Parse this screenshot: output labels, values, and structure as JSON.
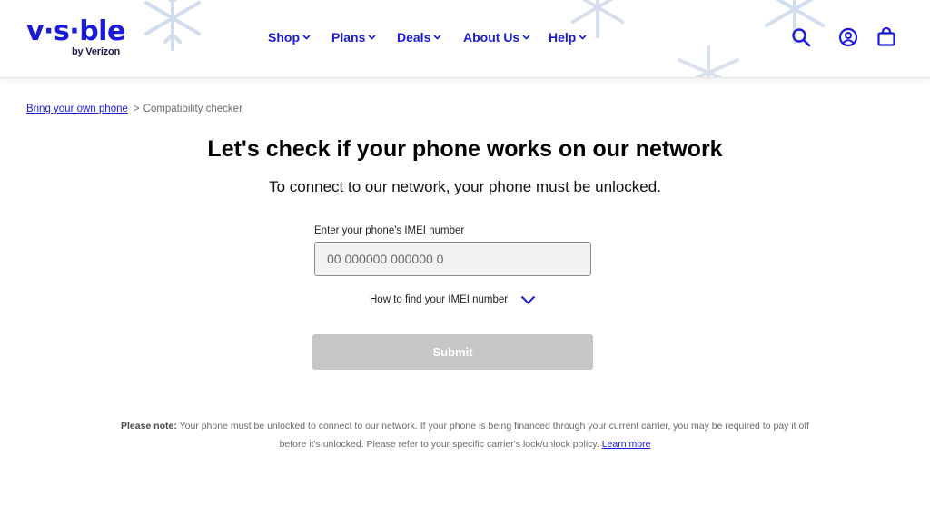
{
  "brand": {
    "logo_text": "v·s·ble",
    "logo_sub": "by Verizon",
    "accent_color": "#1a1adb"
  },
  "nav": {
    "items": [
      {
        "label": "Shop"
      },
      {
        "label": "Plans"
      },
      {
        "label": "Deals"
      },
      {
        "label": "About Us"
      },
      {
        "label": "Help"
      }
    ]
  },
  "header_icons": [
    "search-icon",
    "account-icon",
    "bag-icon"
  ],
  "breadcrumb": {
    "link_label": "Bring your own phone",
    "separator": ">",
    "current": "Compatibility checker"
  },
  "main": {
    "title": "Let's check if your phone works on our network",
    "subtitle": "To connect to our network, your phone must be unlocked.",
    "imei_label": "Enter your phone's IMEI number",
    "imei_placeholder": "00 000000 000000 0",
    "imei_value": "",
    "howto_label": "How to find your IMEI number",
    "submit_label": "Submit"
  },
  "footnote": {
    "prefix": "Please note:",
    "text": " Your phone must be unlocked to connect to our network. If your phone is being financed through your current carrier, you may be required to pay it off before it's unlocked. Please refer to your specific carrier's lock/unlock policy. ",
    "link_label": "Learn more"
  }
}
